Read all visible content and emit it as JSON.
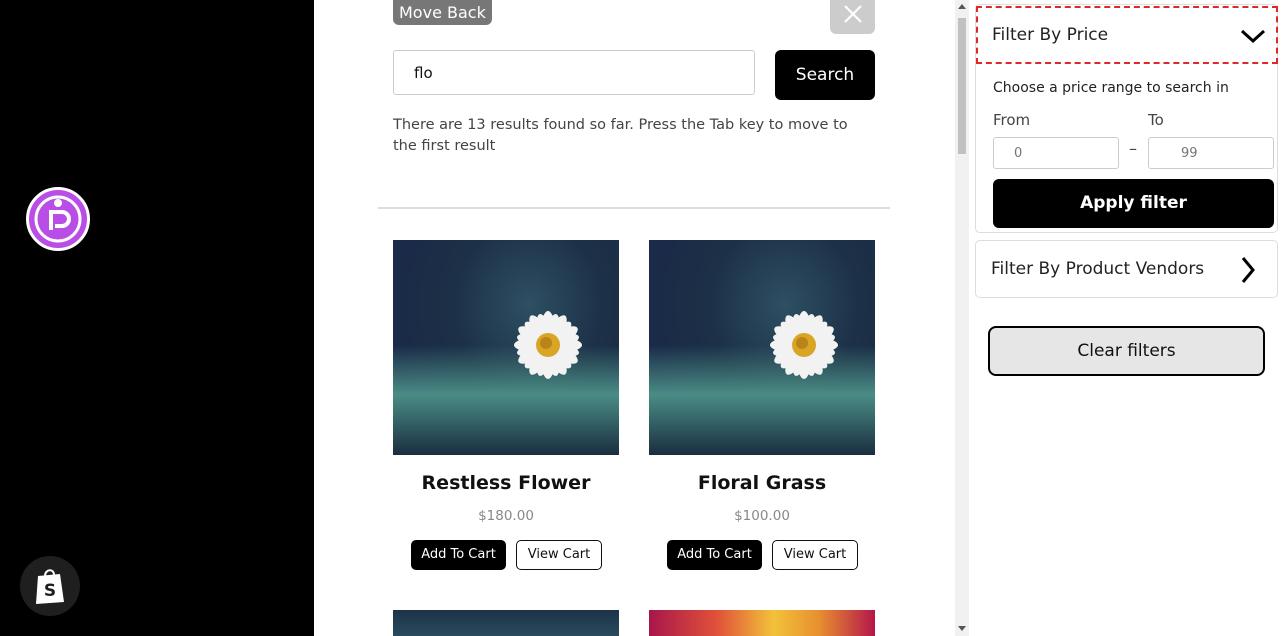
{
  "left_panel": {
    "brand_logo_icon": "brand-logo-icon",
    "shopify_icon": "shopify-bag-icon"
  },
  "main": {
    "move_back_label": "Move Back",
    "close_icon": "close-icon",
    "search": {
      "value": "flo",
      "button_label": "Search"
    },
    "results_text": "There are 13 results found so far. Press the Tab key to move to the first result",
    "products": [
      {
        "name": "Restless Flower",
        "price": "$180.00",
        "add_label": "Add To Cart",
        "view_label": "View Cart"
      },
      {
        "name": "Floral Grass",
        "price": "$100.00",
        "add_label": "Add To Cart",
        "view_label": "View Cart"
      }
    ]
  },
  "sidebar": {
    "price_filter": {
      "title": "Filter By Price",
      "help_text": "Choose a price range to search in",
      "from_label": "From",
      "to_label": "To",
      "from_placeholder": "0",
      "to_placeholder": "99",
      "separator": "–",
      "apply_label": "Apply filter",
      "toggle_icon": "chevron-down-icon"
    },
    "vendors_filter": {
      "title": "Filter By Product Vendors",
      "toggle_icon": "chevron-right-icon"
    },
    "clear_label": "Clear filters"
  },
  "colors": {
    "focus_outline": "#e0282a",
    "brand_purple": "#b94ee6",
    "button_black": "#000000"
  }
}
